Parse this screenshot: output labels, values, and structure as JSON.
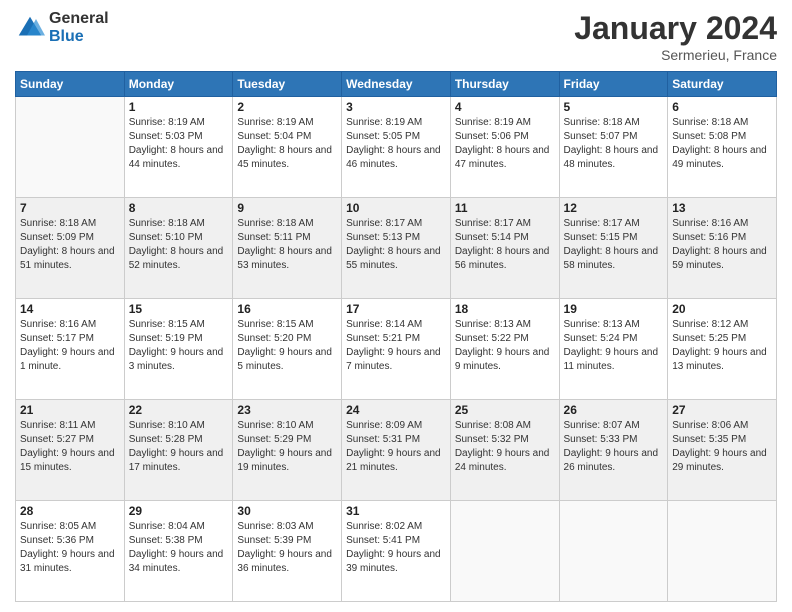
{
  "header": {
    "logo": {
      "general": "General",
      "blue": "Blue"
    },
    "title": "January 2024",
    "subtitle": "Sermerieu, France"
  },
  "weekdays": [
    "Sunday",
    "Monday",
    "Tuesday",
    "Wednesday",
    "Thursday",
    "Friday",
    "Saturday"
  ],
  "weeks": [
    [
      {
        "day": "",
        "sunrise": "",
        "sunset": "",
        "daylight": ""
      },
      {
        "day": "1",
        "sunrise": "Sunrise: 8:19 AM",
        "sunset": "Sunset: 5:03 PM",
        "daylight": "Daylight: 8 hours and 44 minutes."
      },
      {
        "day": "2",
        "sunrise": "Sunrise: 8:19 AM",
        "sunset": "Sunset: 5:04 PM",
        "daylight": "Daylight: 8 hours and 45 minutes."
      },
      {
        "day": "3",
        "sunrise": "Sunrise: 8:19 AM",
        "sunset": "Sunset: 5:05 PM",
        "daylight": "Daylight: 8 hours and 46 minutes."
      },
      {
        "day": "4",
        "sunrise": "Sunrise: 8:19 AM",
        "sunset": "Sunset: 5:06 PM",
        "daylight": "Daylight: 8 hours and 47 minutes."
      },
      {
        "day": "5",
        "sunrise": "Sunrise: 8:18 AM",
        "sunset": "Sunset: 5:07 PM",
        "daylight": "Daylight: 8 hours and 48 minutes."
      },
      {
        "day": "6",
        "sunrise": "Sunrise: 8:18 AM",
        "sunset": "Sunset: 5:08 PM",
        "daylight": "Daylight: 8 hours and 49 minutes."
      }
    ],
    [
      {
        "day": "7",
        "sunrise": "Sunrise: 8:18 AM",
        "sunset": "Sunset: 5:09 PM",
        "daylight": "Daylight: 8 hours and 51 minutes."
      },
      {
        "day": "8",
        "sunrise": "Sunrise: 8:18 AM",
        "sunset": "Sunset: 5:10 PM",
        "daylight": "Daylight: 8 hours and 52 minutes."
      },
      {
        "day": "9",
        "sunrise": "Sunrise: 8:18 AM",
        "sunset": "Sunset: 5:11 PM",
        "daylight": "Daylight: 8 hours and 53 minutes."
      },
      {
        "day": "10",
        "sunrise": "Sunrise: 8:17 AM",
        "sunset": "Sunset: 5:13 PM",
        "daylight": "Daylight: 8 hours and 55 minutes."
      },
      {
        "day": "11",
        "sunrise": "Sunrise: 8:17 AM",
        "sunset": "Sunset: 5:14 PM",
        "daylight": "Daylight: 8 hours and 56 minutes."
      },
      {
        "day": "12",
        "sunrise": "Sunrise: 8:17 AM",
        "sunset": "Sunset: 5:15 PM",
        "daylight": "Daylight: 8 hours and 58 minutes."
      },
      {
        "day": "13",
        "sunrise": "Sunrise: 8:16 AM",
        "sunset": "Sunset: 5:16 PM",
        "daylight": "Daylight: 8 hours and 59 minutes."
      }
    ],
    [
      {
        "day": "14",
        "sunrise": "Sunrise: 8:16 AM",
        "sunset": "Sunset: 5:17 PM",
        "daylight": "Daylight: 9 hours and 1 minute."
      },
      {
        "day": "15",
        "sunrise": "Sunrise: 8:15 AM",
        "sunset": "Sunset: 5:19 PM",
        "daylight": "Daylight: 9 hours and 3 minutes."
      },
      {
        "day": "16",
        "sunrise": "Sunrise: 8:15 AM",
        "sunset": "Sunset: 5:20 PM",
        "daylight": "Daylight: 9 hours and 5 minutes."
      },
      {
        "day": "17",
        "sunrise": "Sunrise: 8:14 AM",
        "sunset": "Sunset: 5:21 PM",
        "daylight": "Daylight: 9 hours and 7 minutes."
      },
      {
        "day": "18",
        "sunrise": "Sunrise: 8:13 AM",
        "sunset": "Sunset: 5:22 PM",
        "daylight": "Daylight: 9 hours and 9 minutes."
      },
      {
        "day": "19",
        "sunrise": "Sunrise: 8:13 AM",
        "sunset": "Sunset: 5:24 PM",
        "daylight": "Daylight: 9 hours and 11 minutes."
      },
      {
        "day": "20",
        "sunrise": "Sunrise: 8:12 AM",
        "sunset": "Sunset: 5:25 PM",
        "daylight": "Daylight: 9 hours and 13 minutes."
      }
    ],
    [
      {
        "day": "21",
        "sunrise": "Sunrise: 8:11 AM",
        "sunset": "Sunset: 5:27 PM",
        "daylight": "Daylight: 9 hours and 15 minutes."
      },
      {
        "day": "22",
        "sunrise": "Sunrise: 8:10 AM",
        "sunset": "Sunset: 5:28 PM",
        "daylight": "Daylight: 9 hours and 17 minutes."
      },
      {
        "day": "23",
        "sunrise": "Sunrise: 8:10 AM",
        "sunset": "Sunset: 5:29 PM",
        "daylight": "Daylight: 9 hours and 19 minutes."
      },
      {
        "day": "24",
        "sunrise": "Sunrise: 8:09 AM",
        "sunset": "Sunset: 5:31 PM",
        "daylight": "Daylight: 9 hours and 21 minutes."
      },
      {
        "day": "25",
        "sunrise": "Sunrise: 8:08 AM",
        "sunset": "Sunset: 5:32 PM",
        "daylight": "Daylight: 9 hours and 24 minutes."
      },
      {
        "day": "26",
        "sunrise": "Sunrise: 8:07 AM",
        "sunset": "Sunset: 5:33 PM",
        "daylight": "Daylight: 9 hours and 26 minutes."
      },
      {
        "day": "27",
        "sunrise": "Sunrise: 8:06 AM",
        "sunset": "Sunset: 5:35 PM",
        "daylight": "Daylight: 9 hours and 29 minutes."
      }
    ],
    [
      {
        "day": "28",
        "sunrise": "Sunrise: 8:05 AM",
        "sunset": "Sunset: 5:36 PM",
        "daylight": "Daylight: 9 hours and 31 minutes."
      },
      {
        "day": "29",
        "sunrise": "Sunrise: 8:04 AM",
        "sunset": "Sunset: 5:38 PM",
        "daylight": "Daylight: 9 hours and 34 minutes."
      },
      {
        "day": "30",
        "sunrise": "Sunrise: 8:03 AM",
        "sunset": "Sunset: 5:39 PM",
        "daylight": "Daylight: 9 hours and 36 minutes."
      },
      {
        "day": "31",
        "sunrise": "Sunrise: 8:02 AM",
        "sunset": "Sunset: 5:41 PM",
        "daylight": "Daylight: 9 hours and 39 minutes."
      },
      {
        "day": "",
        "sunrise": "",
        "sunset": "",
        "daylight": ""
      },
      {
        "day": "",
        "sunrise": "",
        "sunset": "",
        "daylight": ""
      },
      {
        "day": "",
        "sunrise": "",
        "sunset": "",
        "daylight": ""
      }
    ]
  ]
}
